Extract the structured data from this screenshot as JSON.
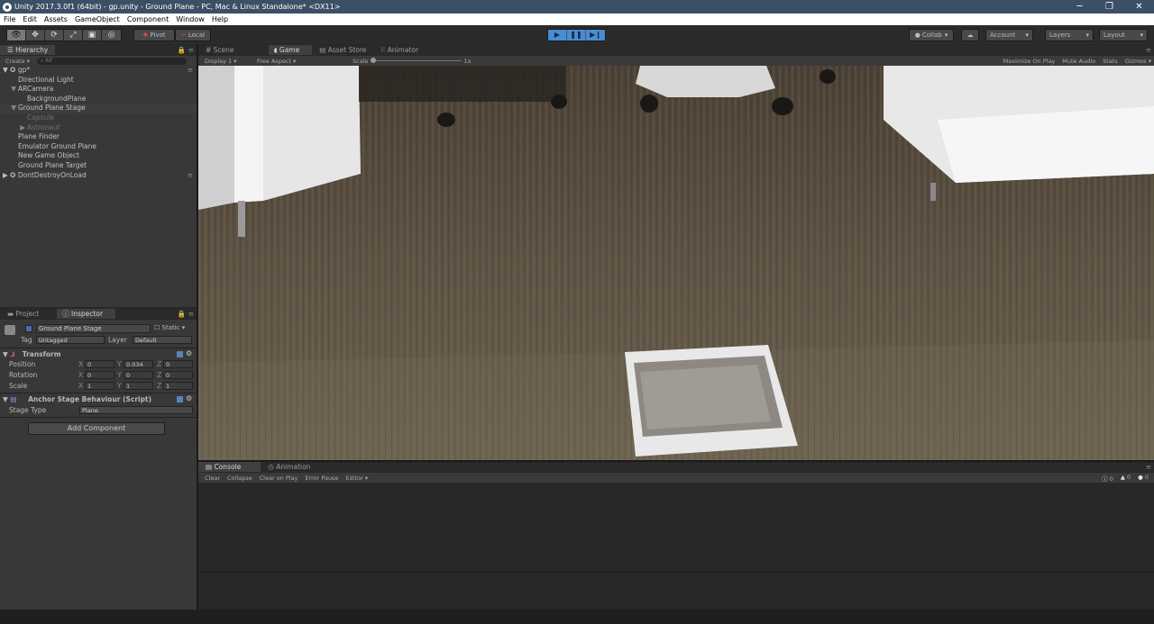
{
  "window": {
    "title": "Unity 2017.3.0f1 (64bit) - gp.unity - Ground Plane - PC, Mac & Linux Standalone* <DX11>",
    "minimize": "─",
    "maximize": "❐",
    "close": "✕"
  },
  "menu": [
    "File",
    "Edit",
    "Assets",
    "GameObject",
    "Component",
    "Window",
    "Help"
  ],
  "toolbar": {
    "pivot": "Pivot",
    "local": "Local",
    "collab": "Collab",
    "account": "Account",
    "layers": "Layers",
    "layout": "Layout"
  },
  "hierarchy": {
    "tab": "Hierarchy",
    "create": "Create",
    "search_placeholder": "All",
    "scene": "gp*",
    "items": [
      {
        "label": "Directional Light",
        "indent": 2,
        "arrow": "",
        "dim": false,
        "selected": false
      },
      {
        "label": "ARCamera",
        "indent": 2,
        "arrow": "▼",
        "dim": false,
        "selected": false
      },
      {
        "label": "BackgroundPlane",
        "indent": 3,
        "arrow": "",
        "dim": false,
        "selected": false
      },
      {
        "label": "Ground Plane Stage",
        "indent": 2,
        "arrow": "▼",
        "dim": false,
        "selected": true
      },
      {
        "label": "Capsule",
        "indent": 3,
        "arrow": "",
        "dim": true,
        "selected": false
      },
      {
        "label": "Astronaut",
        "indent": 3,
        "arrow": "▶",
        "dim": true,
        "selected": false
      },
      {
        "label": "Plane Finder",
        "indent": 2,
        "arrow": "",
        "dim": false,
        "selected": false
      },
      {
        "label": "Emulator Ground Plane",
        "indent": 2,
        "arrow": "",
        "dim": false,
        "selected": false
      },
      {
        "label": "New Game Object",
        "indent": 2,
        "arrow": "",
        "dim": false,
        "selected": false
      },
      {
        "label": "Ground Plane Target",
        "indent": 2,
        "arrow": "",
        "dim": false,
        "selected": false
      }
    ],
    "dont_destroy": "DontDestroyOnLoad"
  },
  "view_tabs": {
    "scene": "Scene",
    "game": "Game",
    "asset_store": "Asset Store",
    "animator": "Animator"
  },
  "game_bar": {
    "display": "Display 1",
    "aspect": "Free Aspect",
    "scale_label": "Scale",
    "scale_value": "1x",
    "maximize_on_play": "Maximize On Play",
    "mute_audio": "Mute Audio",
    "stats": "Stats",
    "gizmos": "Gizmos"
  },
  "inspector": {
    "project_tab": "Project",
    "inspector_tab": "Inspector",
    "object_name": "Ground Plane Stage",
    "static": "Static",
    "tag_label": "Tag",
    "tag_value": "Untagged",
    "layer_label": "Layer",
    "layer_value": "Default",
    "transform": {
      "title": "Transform",
      "position": {
        "label": "Position",
        "x": "0",
        "y": "0.034",
        "z": "0"
      },
      "rotation": {
        "label": "Rotation",
        "x": "0",
        "y": "0",
        "z": "0"
      },
      "scale": {
        "label": "Scale",
        "x": "1",
        "y": "1",
        "z": "1"
      }
    },
    "anchor": {
      "title": "Anchor Stage Behaviour (Script)",
      "stage_type_label": "Stage Type",
      "stage_type_value": "Plane"
    },
    "add_component": "Add Component"
  },
  "console": {
    "console_tab": "Console",
    "animation_tab": "Animation",
    "clear": "Clear",
    "collapse": "Collapse",
    "clear_on_play": "Clear on Play",
    "error_pause": "Error Pause",
    "editor": "Editor",
    "info_count": "0",
    "warn_count": "0",
    "error_count": "0"
  },
  "colors": {
    "title_bar": "#3b4f66",
    "play_accent": "#4a8ccf",
    "panel_bg": "#282828"
  }
}
